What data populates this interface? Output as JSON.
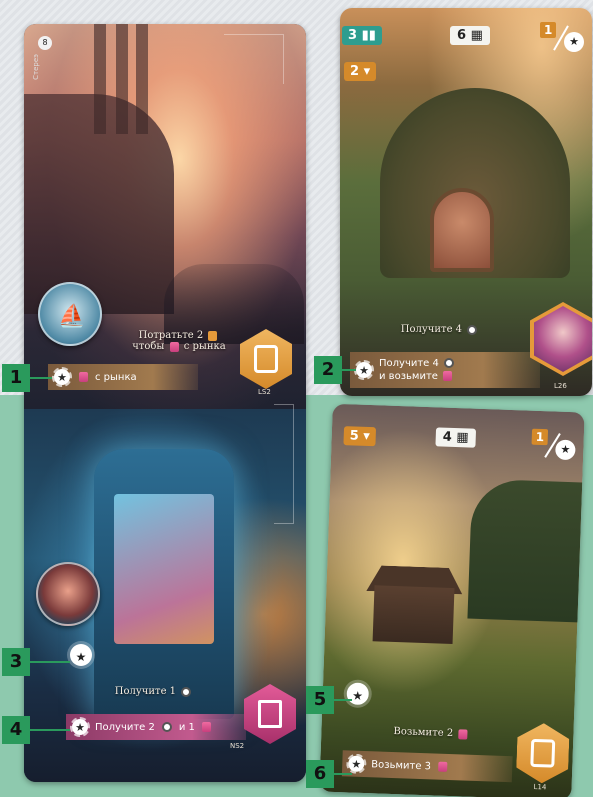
{
  "left_card": {
    "corner_number": "8",
    "side_label": "Стереэ",
    "top_effect_line1": "Потратьте 2",
    "top_effect_line2": "чтобы",
    "top_effect_line2b": "с рынка",
    "top_action": "с рынка",
    "top_code": "LS2",
    "bottom_effect": "Получите 1",
    "bottom_action_a": "Получите 2",
    "bottom_action_b": "и 1",
    "bottom_code": "NS2",
    "hex_top_color": "#e59a3a",
    "hex_bottom_color": "#c83f7d"
  },
  "top_right_card": {
    "badge_teal": "3",
    "badge_white": "6",
    "badge_orange": "2",
    "slash_num": "1",
    "effect": "Получите 4",
    "action_line1": "Получите 4",
    "action_line2": "и возьмите",
    "code": "L26"
  },
  "bottom_right_card": {
    "badge_orange": "5",
    "badge_white": "4",
    "slash_num": "1",
    "effect": "Возьмите 2",
    "action": "Возьмите 3",
    "code": "L14"
  },
  "callouts": {
    "c1": "1",
    "c2": "2",
    "c3": "3",
    "c4": "4",
    "c5": "5",
    "c6": "6"
  },
  "icons": {
    "star_coin": "★",
    "boat": "⛵"
  },
  "colors": {
    "callout_green": "#2a9a5c",
    "mint_background": "#8ec9ae"
  }
}
